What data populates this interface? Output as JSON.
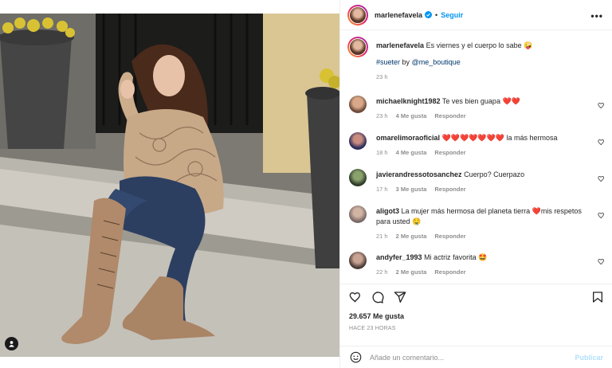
{
  "post": {
    "username": "marlenefavela",
    "separator": "•",
    "follow_label": "Seguir",
    "more_label": "•••"
  },
  "caption": {
    "username": "marlenefavela",
    "text": "Es viernes y el cuerpo lo sabe 🤪",
    "hashtag": "#sueter",
    "by": "by",
    "mention": "@me_boutique",
    "time": "23 h"
  },
  "comments": [
    {
      "username": "michaelknight1982",
      "text": "Te ves bien guapa",
      "emoji": "❤️❤️",
      "time": "23 h",
      "likes": "4 Me gusta",
      "reply": "Responder"
    },
    {
      "username": "omarelimoraoficial",
      "text": "❤️❤️❤️❤️❤️❤️❤️ la más hermosa",
      "emoji": "",
      "time": "18 h",
      "likes": "4 Me gusta",
      "reply": "Responder"
    },
    {
      "username": "javierandressotosanchez",
      "text": "Cuerpo? Cuerpazo",
      "emoji": "",
      "time": "17 h",
      "likes": "3 Me gusta",
      "reply": "Responder"
    },
    {
      "username": "aligot3",
      "text": "La mujer más hermosa del planeta tierra ❤️mis respetos para usted 🤤",
      "emoji": "",
      "time": "21 h",
      "likes": "2 Me gusta",
      "reply": "Responder"
    },
    {
      "username": "andyfer_1993",
      "text": "Mi actriz favorita 🤩",
      "emoji": "",
      "time": "22 h",
      "likes": "2 Me gusta",
      "reply": "Responder"
    }
  ],
  "stats": {
    "likes": "29.657 Me gusta",
    "ago": "HACE 23 HORAS"
  },
  "composer": {
    "placeholder": "Añade un comentario...",
    "publish": "Publicar"
  },
  "icons": {
    "like": "heart-icon",
    "comment": "comment-icon",
    "share": "share-icon",
    "save": "bookmark-icon",
    "emoji": "emoji-icon",
    "more": "more-icon",
    "tag": "user-tag-icon"
  },
  "colors": {
    "accent": "#0095f6",
    "heart": "#ed4956",
    "muted": "#8e8e8e"
  }
}
